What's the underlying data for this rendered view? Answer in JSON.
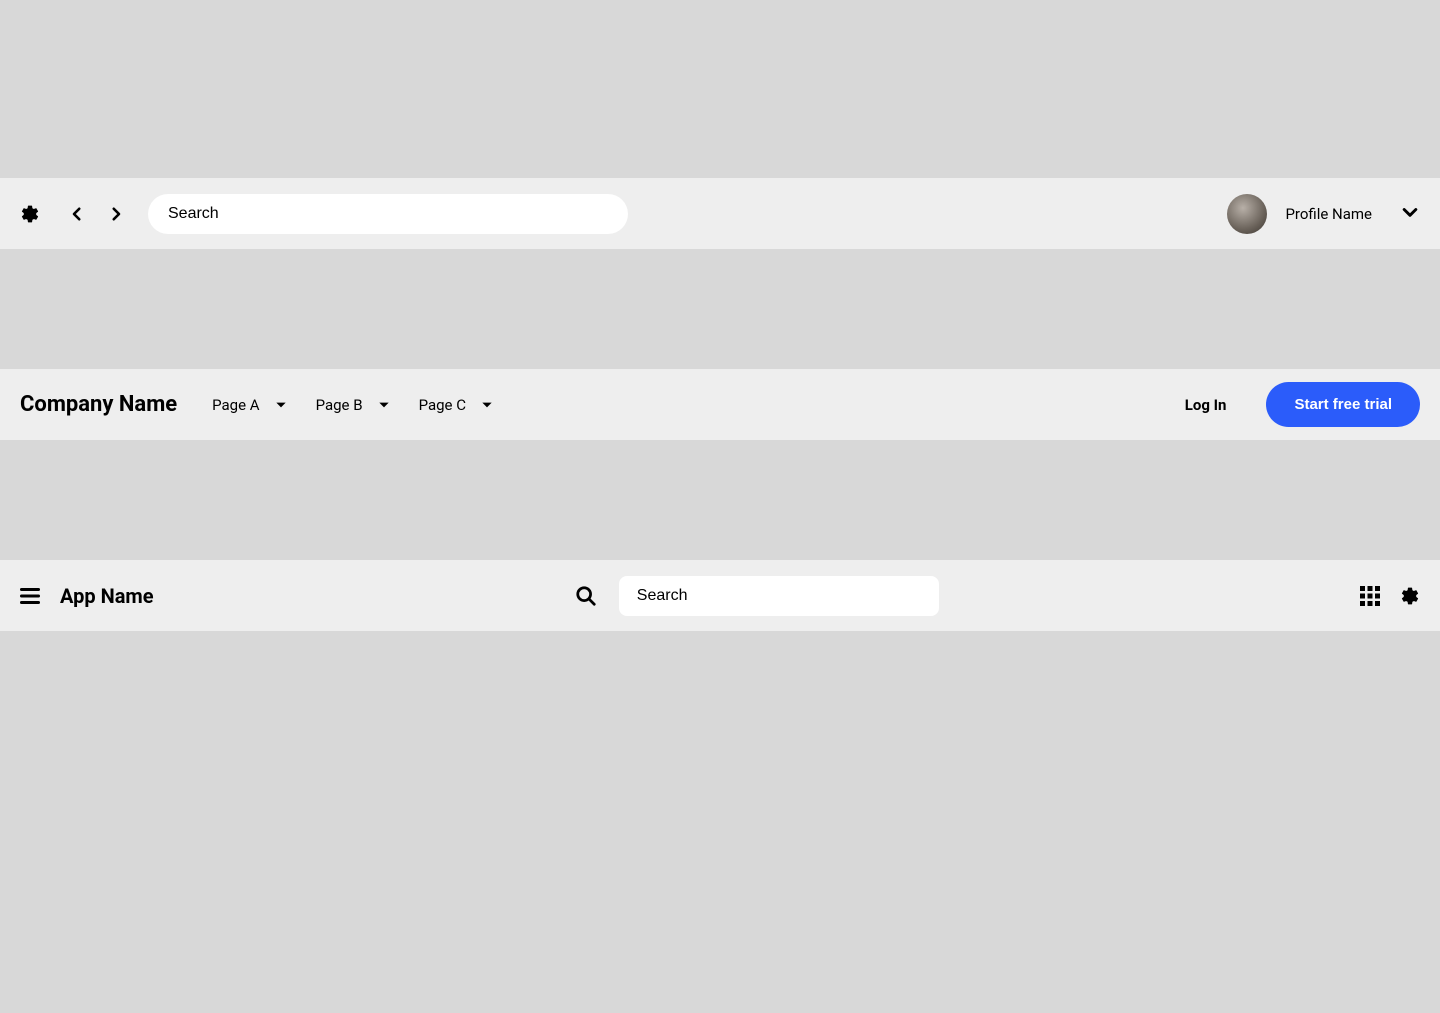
{
  "navbar1": {
    "search_placeholder": "Search",
    "profile_name": "Profile Name"
  },
  "navbar2": {
    "company_name": "Company Name",
    "nav_items": [
      {
        "label": "Page A"
      },
      {
        "label": "Page B"
      },
      {
        "label": "Page C"
      }
    ],
    "login_label": "Log In",
    "cta_label": "Start free trial"
  },
  "navbar3": {
    "app_name": "App Name",
    "search_placeholder": "Search"
  },
  "colors": {
    "primary": "#2B5CFA",
    "navbar_bg": "#eeeeee",
    "page_bg": "#d8d8d8"
  }
}
